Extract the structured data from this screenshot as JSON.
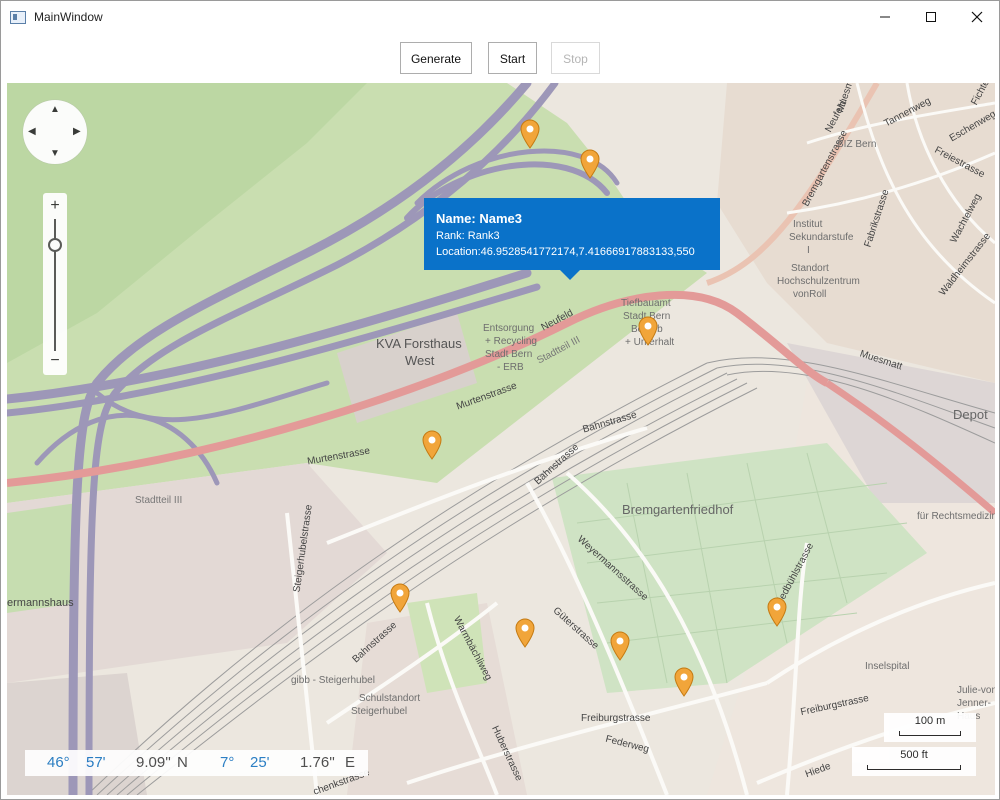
{
  "window": {
    "title": "MainWindow",
    "minimize_icon": "minimize-icon",
    "maximize_icon": "maximize-icon",
    "close_icon": "close-icon"
  },
  "toolbar": {
    "generate_label": "Generate",
    "start_label": "Start",
    "stop_label": "Stop",
    "stop_enabled": false
  },
  "map": {
    "labels": {
      "kva": "KVA Forsthaus",
      "kva2": "West",
      "entsorgung": "Entsorgung",
      "recycling": "+ Recycling",
      "stadt_bern": "Stadt Bern",
      "erb": "- ERB",
      "tiefbauamt": "Tiefbauamt",
      "tief_stadt": "Stadt Bern",
      "tief_betrieb": "Betrieb",
      "tief_unterhalt": "+ Unterhalt",
      "neufeld": "Neufeld",
      "neufeld2": "Neufeld",
      "stadtteil": "Stadtteil III",
      "stadtteil2": "Stadtteil III",
      "murtenstrasse": "Murtenstrasse",
      "murtenstrasse2": "Murtenstrasse",
      "bahnstrasse": "Bahnstrasse",
      "bahnstrasse2": "Bahnstrasse",
      "bahnstrasse3": "Bahnstrasse",
      "bremgartenfriedhof": "Bremgartenfriedhof",
      "weyermannsstrasse": "Weyermannsstrasse",
      "gutenstrasse": "Güterstrasse",
      "warmbachweg": "Warmbächliweg",
      "huberstrasse": "Huberstrasse",
      "freiburgstrasse": "Freiburgstrasse",
      "freiburgstrasse2": "Freiburgstrasse",
      "federweg": "Federweg",
      "steigerhubelstrasse": "Steigerhubelstrasse",
      "gibb": "gibb - Steigerhubel",
      "schulstandort": "Schulstandort",
      "schul2": "Steigerhubel",
      "ermannshaus": "ermannshaus",
      "bremgartenstrasse": "Bremgartenstrasse",
      "fabrikstrasse": "Fabrikstrasse",
      "tannenweg": "Tannenweg",
      "eschenweg": "Eschenweg",
      "freiestrasse": "Freiestrasse",
      "wachtelweg": "Wachtelweg",
      "waldheimstrasse": "Waldheimstrasse",
      "biz": "BIZ Bern",
      "institut": "Institut",
      "sekundarstufe": "Sekundarstufe",
      "i": "I",
      "standort": "Standort",
      "hochschulzentrum": "Hochschulzentrum",
      "vonroll": "vonRoll",
      "muesmatt": "Muesmatt",
      "muesm": "Muesm",
      "depot": "Depot",
      "rechtsmedizin": "für Rechtsmedizin",
      "friedbuhlstrasse": "Friedbühlstrasse",
      "inselspital": "Inselspital",
      "julie1": "Julie-von-",
      "julie2": "Jenner-",
      "julie3": "Haus",
      "hiede": "Hiede",
      "fichte": "Fichte",
      "chenkstrasse": "chenkstrasse"
    },
    "callout": {
      "name_line": "Name: Name3",
      "rank_line": "Rank: Rank3",
      "location_line": "Location:46.9528541772174,7.41666917883133,550"
    },
    "nav": {
      "up": "▲",
      "down": "▼",
      "left": "◀",
      "right": "▶"
    },
    "zoom": {
      "plus": "+",
      "minus": "−",
      "level_fraction": 0.2
    },
    "coords": {
      "lat_deg": "46°",
      "lat_min": "57'",
      "lat_sec": "9.09''",
      "lat_dir": "N",
      "lon_deg": "7°",
      "lon_min": "25'",
      "lon_sec": "1.76''",
      "lon_dir": "E"
    },
    "scale": {
      "metric": "100 m",
      "imperial": "500 ft"
    },
    "pin_count": 10
  },
  "colors": {
    "callout_bg": "#0a72c9",
    "coord_accent": "#1e78c2",
    "pin_orange": "#f1a53a",
    "motorway": "#9d97b8",
    "primary_road": "#e58d8d",
    "park": "#c8dfb0"
  }
}
